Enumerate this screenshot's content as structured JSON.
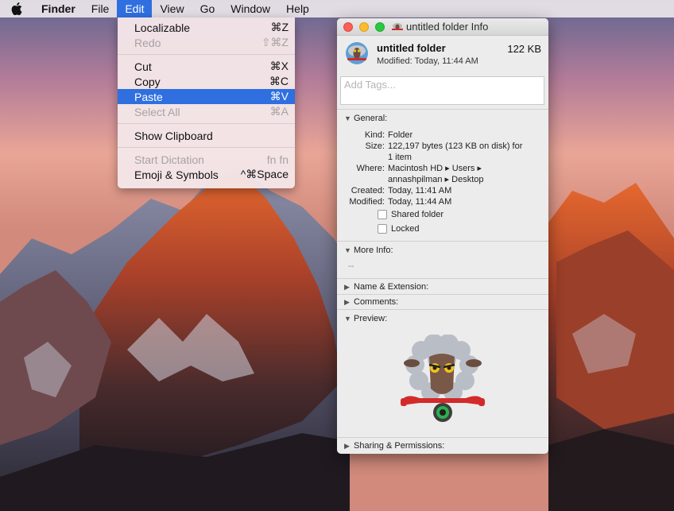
{
  "menubar": {
    "app": "Finder",
    "items": [
      "File",
      "Edit",
      "View",
      "Go",
      "Window",
      "Help"
    ],
    "active": "Edit"
  },
  "edit_menu": {
    "items": [
      {
        "label": "Localizable",
        "shortcut": "⌘Z",
        "state": "enabled"
      },
      {
        "label": "Redo",
        "shortcut": "⇧⌘Z",
        "state": "disabled"
      },
      {
        "label": "Cut",
        "shortcut": "⌘X",
        "state": "enabled"
      },
      {
        "label": "Copy",
        "shortcut": "⌘C",
        "state": "enabled"
      },
      {
        "label": "Paste",
        "shortcut": "⌘V",
        "state": "highlighted"
      },
      {
        "label": "Select All",
        "shortcut": "⌘A",
        "state": "disabled"
      },
      {
        "label": "Show Clipboard",
        "shortcut": "",
        "state": "enabled"
      },
      {
        "label": "Start Dictation",
        "shortcut": "fn fn",
        "state": "disabled"
      },
      {
        "label": "Emoji & Symbols",
        "shortcut": "^⌘Space",
        "state": "enabled"
      }
    ]
  },
  "info_window": {
    "title": "untitled folder Info",
    "file_name": "untitled folder",
    "modified_line": "Modified: Today, 11:44 AM",
    "size": "122 KB",
    "tags_placeholder": "Add Tags...",
    "general": {
      "heading": "General:",
      "kind_label": "Kind:",
      "kind": "Folder",
      "size_label": "Size:",
      "size_line1": "122,197 bytes (123 KB on disk) for",
      "size_line2": "1 item",
      "where_label": "Where:",
      "where_line1": "Macintosh HD ▸ Users ▸",
      "where_line2": "annashpilman ▸ Desktop",
      "created_label": "Created:",
      "created": "Today, 11:41 AM",
      "modified_label": "Modified:",
      "modified": "Today, 11:44 AM",
      "shared_label": "Shared folder",
      "locked_label": "Locked"
    },
    "more_info": {
      "heading": "More Info:",
      "value": "--"
    },
    "name_extension": "Name & Extension:",
    "comments": "Comments:",
    "preview": "Preview:",
    "sharing": "Sharing & Permissions:"
  },
  "colors": {
    "accent": "#2f6fe0",
    "close": "#fc5f57",
    "minimize": "#fdbc2e",
    "zoom": "#28c840"
  }
}
